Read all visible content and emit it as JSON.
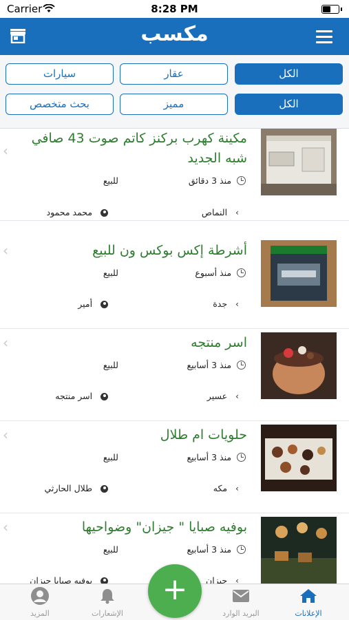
{
  "status_bar": {
    "carrier": "Carrier",
    "time": "8:28 PM"
  },
  "navbar": {
    "logo": "مكسب"
  },
  "filters": {
    "row1": [
      "الكل",
      "عقار",
      "سيارات"
    ],
    "row2": [
      "الكل",
      "مميز",
      "بحث متخصص"
    ]
  },
  "listings": [
    {
      "title": "مكينة كهرب بركنز كاتم صوت 43 صافي شبه الجديد",
      "time": "منذ 3 دقائق",
      "type": "للبيع",
      "city": "النماص",
      "user": "محمد محمود"
    },
    {
      "title": "أشرطة إكس بوكس ون للبيع",
      "time": "منذ أسبوع",
      "type": "للبيع",
      "city": "جدة",
      "user": "أمير"
    },
    {
      "title": "اسر منتجه",
      "time": "منذ 3 أسابيع",
      "type": "للبيع",
      "city": "عسير",
      "user": "اسر منتجه"
    },
    {
      "title": "حلويات ام طلال",
      "time": "منذ 3 أسابيع",
      "type": "للبيع",
      "city": "مكه",
      "user": "طلال الحارثي"
    },
    {
      "title": "بوفيه صبايا \" جيزان\" وضواحيها",
      "time": "منذ 3 أسابيع",
      "type": "للبيع",
      "city": "جيزان",
      "user": "بوفيه صبايا جيزان"
    }
  ],
  "tabbar": {
    "tabs": [
      "الإعلانات",
      "البريد الوارد",
      "الإشعارات",
      "المزيد"
    ],
    "add_label": "+"
  },
  "colors": {
    "primary": "#1a6fbd",
    "title_green": "#2d7d2e",
    "fab_green": "#4cae4f"
  },
  "icons": [
    "wifi-icon",
    "battery-icon",
    "store-icon",
    "menu-icon",
    "clock-icon",
    "person-pin-icon",
    "chevron-left-icon",
    "home-icon",
    "mail-icon",
    "bell-icon",
    "user-icon",
    "plus-icon"
  ]
}
